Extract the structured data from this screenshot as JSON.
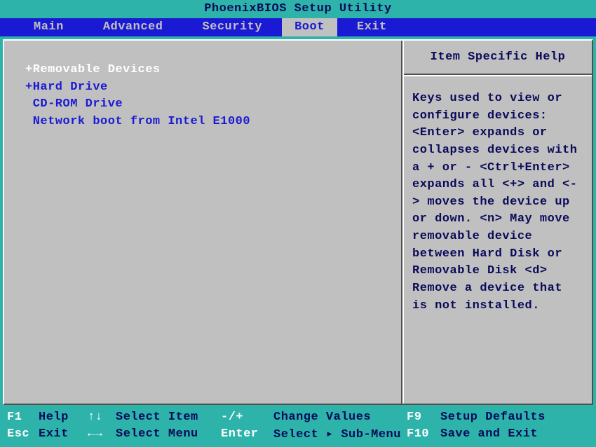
{
  "title": "PhoenixBIOS Setup Utility",
  "menu": {
    "items": [
      "Main",
      "Advanced",
      "Security",
      "Boot",
      "Exit"
    ],
    "active_index": 3
  },
  "boot_list": {
    "items": [
      {
        "prefix": "+",
        "label": "Removable Devices",
        "selected": true
      },
      {
        "prefix": "+",
        "label": "Hard Drive",
        "selected": false
      },
      {
        "prefix": " ",
        "label": "CD-ROM Drive",
        "selected": false
      },
      {
        "prefix": " ",
        "label": "Network boot from Intel E1000",
        "selected": false
      }
    ]
  },
  "help": {
    "title": "Item Specific Help",
    "body": "Keys used to view or configure devices:\n<Enter> expands or collapses devices with a + or -\n<Ctrl+Enter> expands all\n<+> and <-> moves the device up or down.\n<n> May move removable device between Hard Disk or Removable Disk\n<d> Remove a device that is not installed."
  },
  "footer": {
    "r1": {
      "k1": "F1",
      "l1": "Help",
      "k2": "↑↓",
      "l2": "Select Item",
      "k3": "-/+",
      "l3": "Change Values",
      "k4": "F9",
      "l4": "Setup Defaults"
    },
    "r2": {
      "k1": "Esc",
      "l1": "Exit",
      "k2": "←→",
      "l2": "Select Menu",
      "k3": "Enter",
      "l3": "Select ▸ Sub-Menu",
      "k4": "F10",
      "l4": "Save and Exit"
    }
  }
}
